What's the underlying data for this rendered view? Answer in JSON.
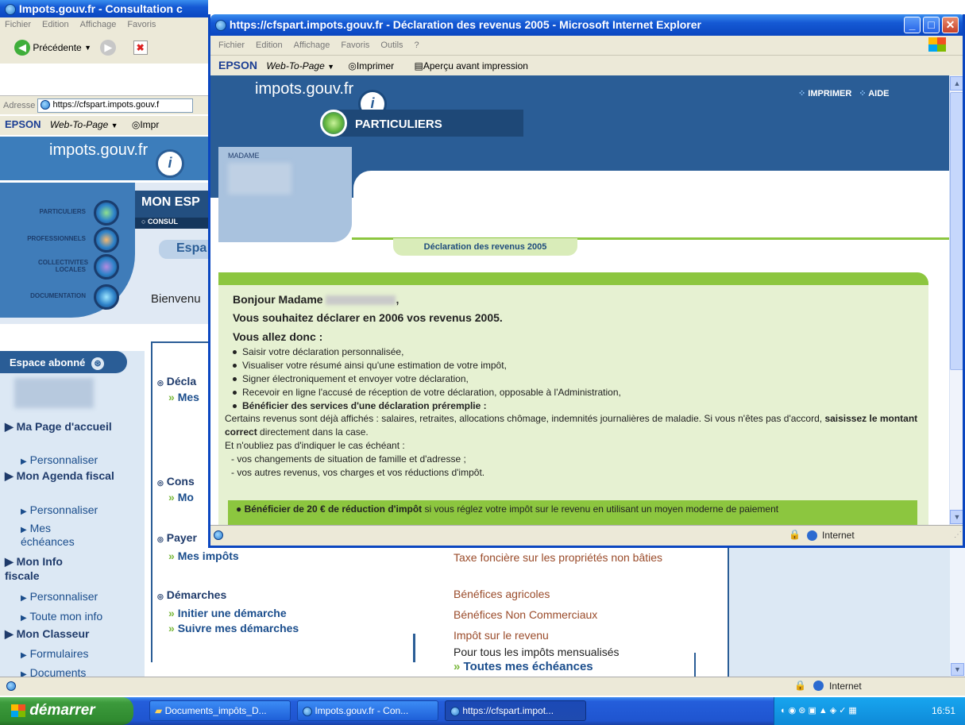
{
  "back_window": {
    "title": "Impots.gouv.fr - Consultation c",
    "menu": [
      "Fichier",
      "Edition",
      "Affichage",
      "Favoris"
    ],
    "back_label": "Précédente",
    "address_label": "Adresse",
    "address_value": "https://cfspart.impots.gouv.f",
    "epson": {
      "brand": "EPSON",
      "web": "Web-To-Page",
      "print": "Impr"
    },
    "logo_text": "impots.gouv.fr",
    "nav": [
      "PARTICULIERS",
      "PROFESSIONNELS",
      "COLLECTIVITES LOCALES",
      "DOCUMENTATION"
    ],
    "header_title": "MON ESP",
    "header_sub": "CONSUL",
    "tab": "Espa",
    "welcome": "Bienvenu",
    "sidebar": {
      "title": "Espace abonné",
      "items": [
        {
          "label": "Ma Page d'accueil",
          "sub": [
            "Personnaliser"
          ]
        },
        {
          "label": "Mon Agenda fiscal",
          "sub": [
            "Personnaliser",
            "Mes échéances"
          ]
        },
        {
          "label": "Mon Info fiscale",
          "sub": [
            "Personnaliser",
            "Toute mon info"
          ]
        },
        {
          "label": "Mon Classeur",
          "sub": [
            "Formulaires",
            "Documents"
          ]
        }
      ]
    },
    "sections": [
      {
        "title": "Décla",
        "link": "Mes"
      },
      {
        "title": "Cons",
        "link": "Mo"
      },
      {
        "title": "Payer",
        "link": "Mes impôts"
      },
      {
        "title": "Démarches",
        "links": [
          "Initier une démarche",
          "Suivre mes démarches"
        ]
      }
    ],
    "taxes": [
      "Taxe foncière sur les propriétés non bâties",
      "Bénéfices agricoles",
      "Bénéfices Non Commerciaux",
      "Impôt sur le revenu"
    ],
    "mensualises": "Pour tous les impôts mensualisés",
    "all_deadlines": "Toutes mes échéances",
    "status_zone": "Internet"
  },
  "front_window": {
    "title": "https://cfspart.impots.gouv.fr - Déclaration des revenus 2005 - Microsoft Internet Explorer",
    "menu": [
      "Fichier",
      "Edition",
      "Affichage",
      "Favoris",
      "Outils",
      "?"
    ],
    "epson": {
      "brand": "EPSON",
      "web": "Web-To-Page",
      "print": "Imprimer",
      "preview": "Aperçu avant impression"
    },
    "logo_text": "impots.gouv.fr",
    "top_links": {
      "print": "IMPRIMER",
      "help": "AIDE"
    },
    "section": "PARTICULIERS",
    "madame": "MADAME",
    "tab_label": "Déclaration des revenus 2005",
    "greeting": "Bonjour Madame",
    "intro": "Vous souhaitez déclarer en 2006 vos revenus 2005.",
    "you_will": "Vous allez donc :",
    "bullets": [
      "Saisir votre déclaration personnalisée,",
      "Visualiser votre résumé ainsi qu'une estimation de votre impôt,",
      "Signer électroniquement et envoyer votre déclaration,",
      "Recevoir en ligne l'accusé de réception de votre déclaration, opposable à l'Administration,"
    ],
    "prefilled_bullet": "Bénéficier des services d'une déclaration préremplie :",
    "para1_a": "Certains revenus sont déjà affichés : salaires, retraites, allocations chômage, indemnités journalières de maladie. Si vous n'êtes pas d'accord, ",
    "para1_b": "saisissez le montant correct",
    "para1_c": " directement dans la case.",
    "para2": "Et n'oubliez pas d'indiquer le cas échéant :",
    "dash1": "- vos changements de situation de famille et d'adresse ;",
    "dash2": "- vos autres revenus, vos charges et vos réductions d'impôt.",
    "reduction_bold": "Bénéficier de 20 € de réduction d'impôt",
    "reduction_rest": " si vous réglez votre impôt sur le revenu en utilisant un moyen moderne de paiement",
    "status_zone": "Internet"
  },
  "taskbar": {
    "start": "démarrer",
    "tasks": [
      "Documents_impôts_D...",
      "Impots.gouv.fr - Con...",
      "https://cfspart.impot..."
    ],
    "clock": "16:51"
  },
  "colors": {
    "xp_blue": "#1559d4",
    "navy": "#2a5d96",
    "green": "#8cc63f",
    "light_green": "#e6f1d2"
  }
}
